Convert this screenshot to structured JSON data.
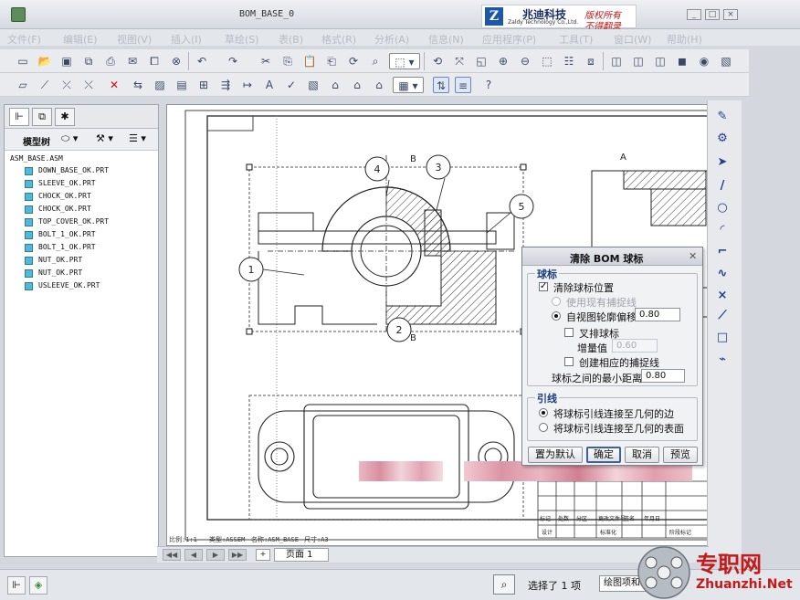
{
  "window": {
    "title": "BOM_BASE_0"
  },
  "brand": {
    "logo_letter": "Z",
    "name_cn": "兆迪科技",
    "name_en": "Zaldy Technology Co.,Ltd.",
    "slogan_1": "版权所有",
    "slogan_2": "不得翻录"
  },
  "menu": [
    "文件(F)",
    "编辑(E)",
    "视图(V)",
    "插入(I)",
    "草绘(S)",
    "表(B)",
    "格式(R)",
    "分析(A)",
    "信息(N)",
    "应用程序(P)",
    "工具(T)",
    "窗口(W)",
    "帮助(H)"
  ],
  "model_tree": {
    "header": "模型树",
    "root": "ASM_BASE.ASM",
    "items": [
      "DOWN_BASE_OK.PRT",
      "SLEEVE_OK.PRT",
      "CHOCK_OK.PRT",
      "CHOCK_OK.PRT",
      "TOP_COVER_OK.PRT",
      "BOLT_1_OK.PRT",
      "BOLT_1_OK.PRT",
      "NUT_OK.PRT",
      "NUT_OK.PRT",
      "USLEEVE_OK.PRT"
    ]
  },
  "drawing": {
    "balloons": [
      "1",
      "2",
      "3",
      "4",
      "5"
    ],
    "section_a": "A",
    "section_b": "B",
    "notes": {
      "scale": "比例:1:1",
      "type": "类型:ASSEM",
      "name": "名称:ASM_BASE",
      "size": "尺寸:A3"
    },
    "title_block": [
      "标记",
      "处数",
      "分区",
      "更改文件号",
      "签名",
      "年月日",
      "设计",
      "标准化",
      "阶段标记"
    ]
  },
  "dialog": {
    "title": "清除 BOM 球标",
    "group_balloon": "球标",
    "clear_position": {
      "label": "清除球标位置",
      "checked": true
    },
    "use_existing": {
      "label": "使用现有捕捉线",
      "enabled": false
    },
    "offset": {
      "label": "自视图轮廓偏移",
      "value": "0.80",
      "selected": true
    },
    "stagger": {
      "label": "叉排球标",
      "checked": false
    },
    "increment": {
      "label": "增量值",
      "value": "0.60",
      "enabled": false
    },
    "create_snap": {
      "label": "创建相应的捕捉线",
      "checked": false
    },
    "min_distance": {
      "label": "球标之间的最小距离",
      "value": "0.80"
    },
    "group_leader": "引线",
    "leader_edge": {
      "label": "将球标引线连接至几何的边",
      "selected": true
    },
    "leader_surface": {
      "label": "将球标引线连接至几何的表面",
      "selected": false
    },
    "buttons": {
      "defaults": "置为默认",
      "ok": "确定",
      "cancel": "取消",
      "preview": "预览"
    }
  },
  "pagebar": {
    "page_label": "页面 1"
  },
  "status": {
    "message": "选择了 1 项",
    "filter": "绘图项和"
  },
  "watermark": {
    "cn": "专职网",
    "en": "Zhuanzhi.Net"
  }
}
